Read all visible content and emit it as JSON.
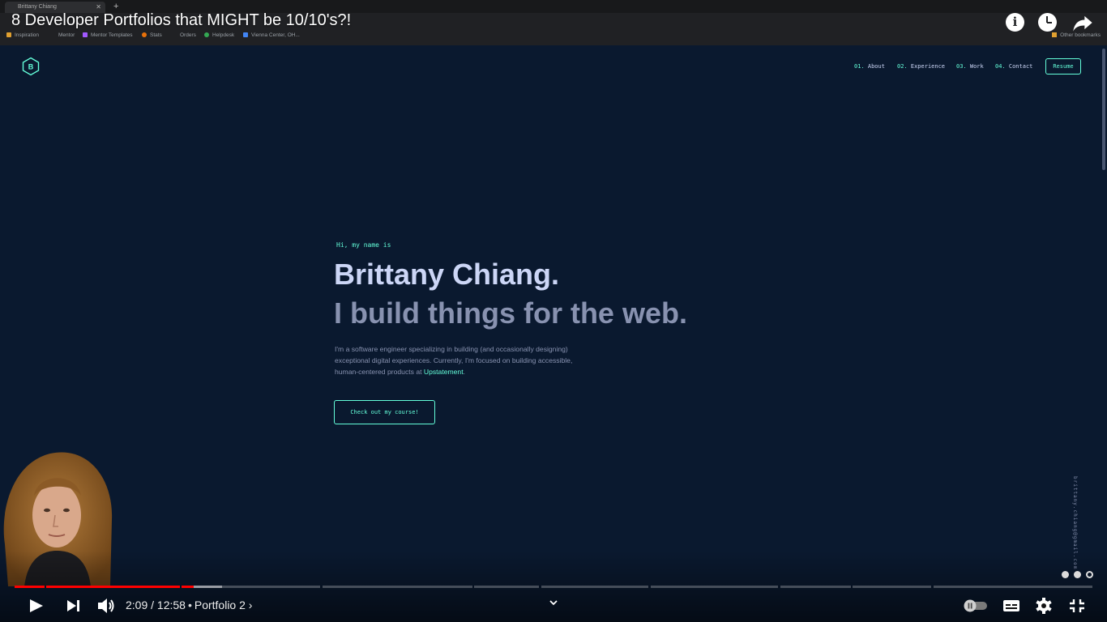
{
  "browser": {
    "tab_title": "Brittany Chiang",
    "tab_close": "✕",
    "new_tab": "+",
    "bookmarks": [
      {
        "label": "Inspiration",
        "color": "#e0a030"
      },
      {
        "label": "Mentor",
        "color": "#3a3b3e"
      },
      {
        "label": "Mentor Templates",
        "color": "#a259ff"
      },
      {
        "label": "Stats",
        "color": "#e8710a"
      },
      {
        "label": "Orders",
        "color": "#3a3b3e"
      },
      {
        "label": "Helpdesk",
        "color": "#34a853"
      },
      {
        "label": "Vienna Center, OH...",
        "color": "#4285f4"
      }
    ],
    "other_bookmarks": "Other bookmarks"
  },
  "video": {
    "title": "8 Developer Portfolios that MIGHT be 10/10's?!",
    "current_time": "2:09",
    "duration": "12:58",
    "time_display": "2:09 / 12:58",
    "separator": "•",
    "chapter": "Portfolio 2",
    "chapter_chevron": "›",
    "progress_fraction": 0.166,
    "accent_color": "#ff0000",
    "controls": {
      "play": "play-icon",
      "next": "next-icon",
      "volume": "volume-icon",
      "autoplay": "autoplay-toggle",
      "captions": "subtitles-icon",
      "settings": "gear-icon",
      "exit_fullscreen": "exit-fullscreen-icon"
    }
  },
  "site": {
    "logo_letter": "B",
    "nav": [
      {
        "num": "01.",
        "label": "About"
      },
      {
        "num": "02.",
        "label": "Experience"
      },
      {
        "num": "03.",
        "label": "Work"
      },
      {
        "num": "04.",
        "label": "Contact"
      }
    ],
    "resume_label": "Resume",
    "greeting": "Hi, my name is",
    "name": "Brittany Chiang.",
    "tagline": "I build things for the web.",
    "description_lead": "I'm a software engineer specializing in building (and occasionally designing) exceptional digital experiences. Currently, I'm focused on building accessible, human-centered products at ",
    "description_link": "Upstatement",
    "description_end": ".",
    "cta_label": "Check out my course!",
    "side_email": "brittany.chiang@gmail.com",
    "colors": {
      "background": "#0a192f",
      "accent": "#64ffda",
      "heading": "#ccd6f6",
      "muted": "#8892b0"
    }
  }
}
